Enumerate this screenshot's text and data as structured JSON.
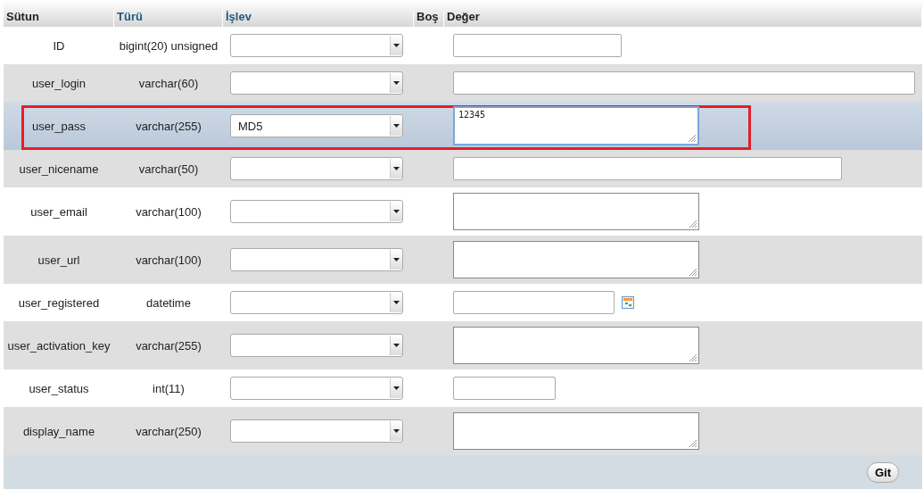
{
  "table": {
    "columns": [
      "Sütun",
      "Türü",
      "İşlev",
      "Boş",
      "Değer"
    ],
    "rows": [
      {
        "name": "ID",
        "type": "bigint(20) unsigned",
        "function": "",
        "value": "",
        "kind": "input-medium",
        "selected": false
      },
      {
        "name": "user_login",
        "type": "varchar(60)",
        "function": "",
        "value": "",
        "kind": "input-wide",
        "selected": false
      },
      {
        "name": "user_pass",
        "type": "varchar(255)",
        "function": "MD5",
        "value": "12345",
        "kind": "textarea",
        "selected": true
      },
      {
        "name": "user_nicename",
        "type": "varchar(50)",
        "function": "",
        "value": "",
        "kind": "input-long",
        "selected": false
      },
      {
        "name": "user_email",
        "type": "varchar(100)",
        "function": "",
        "value": "",
        "kind": "textarea",
        "selected": false
      },
      {
        "name": "user_url",
        "type": "varchar(100)",
        "function": "",
        "value": "",
        "kind": "textarea",
        "selected": false
      },
      {
        "name": "user_registered",
        "type": "datetime",
        "function": "",
        "value": "",
        "kind": "date",
        "selected": false
      },
      {
        "name": "user_activation_key",
        "type": "varchar(255)",
        "function": "",
        "value": "",
        "kind": "textarea",
        "selected": false
      },
      {
        "name": "user_status",
        "type": "int(11)",
        "function": "",
        "value": "",
        "kind": "input-short",
        "selected": false
      },
      {
        "name": "display_name",
        "type": "varchar(250)",
        "function": "",
        "value": "",
        "kind": "textarea",
        "selected": false
      }
    ]
  },
  "submit": "Git"
}
